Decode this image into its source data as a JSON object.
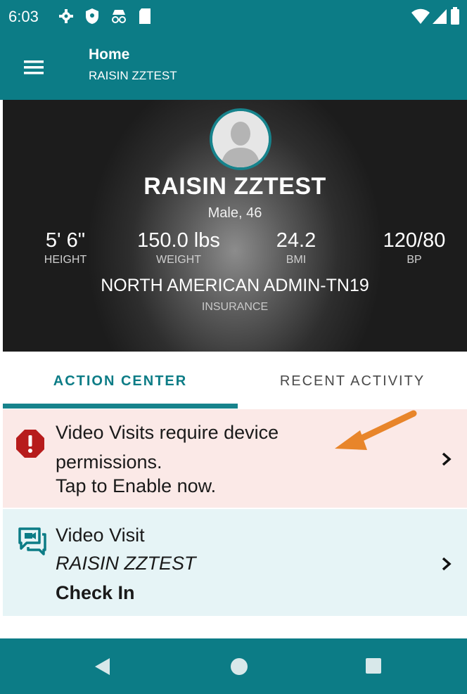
{
  "status": {
    "time": "6:03"
  },
  "appbar": {
    "title": "Home",
    "subtitle": "RAISIN ZZTEST"
  },
  "profile": {
    "name": "RAISIN ZZTEST",
    "demographics": "Male, 46",
    "stats": [
      {
        "value": "5' 6\"",
        "label": "HEIGHT"
      },
      {
        "value": "150.0 lbs",
        "label": "WEIGHT"
      },
      {
        "value": "24.2",
        "label": "BMI"
      },
      {
        "value": "120/80",
        "label": "BP"
      }
    ],
    "insurance": "NORTH AMERICAN ADMIN-TN19",
    "insurance_label": "INSURANCE"
  },
  "tabs": {
    "action_center": "ACTION CENTER",
    "recent_activity": "RECENT ACTIVITY"
  },
  "alert": {
    "line1": "Video Visits require device",
    "line2": "permissions.",
    "line3": "Tap to Enable now."
  },
  "visit": {
    "type": "Video Visit",
    "patient": "RAISIN ZZTEST",
    "action": "Check In"
  },
  "colors": {
    "teal": "#0c7c86",
    "alert_bg": "#fbe9e7",
    "visit_bg": "#e6f4f6",
    "alert_icon": "#b71c1c",
    "arrow": "#e8852a"
  }
}
